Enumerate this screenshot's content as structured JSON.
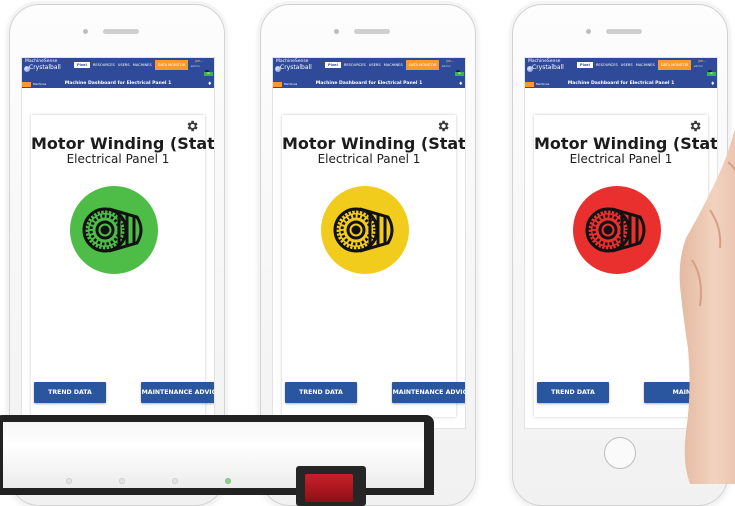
{
  "dashboard": {
    "brand_line1": "MachineSense",
    "brand_line2": "Crystalball",
    "nav": {
      "pixel": "Pixel",
      "resources": "RESOURCES",
      "users": "USERS",
      "machines": "MACHINES",
      "data_monitor": "DATA MONITOR"
    },
    "user": {
      "name": "joe...",
      "sub": "admin"
    },
    "status_badge": "ok",
    "crumb": "Machines",
    "page_title": "Machine Dashboard for Electrical Panel 1",
    "machine_name": "Motor Winding (Stator)",
    "location": "Electrical Panel 1",
    "buttons": {
      "trend": "TREND DATA",
      "maintenance": "MAINTENANCE ADVICE",
      "maintenance_partial": "MAINT"
    }
  },
  "phones": [
    {
      "status_color": "#4dbd48"
    },
    {
      "status_color": "#f2cc1d"
    },
    {
      "status_color": "#ea2f2f"
    }
  ],
  "icons": {
    "gear": "gear-icon",
    "motor": "motor-winding-icon",
    "bell": "bell-icon"
  }
}
